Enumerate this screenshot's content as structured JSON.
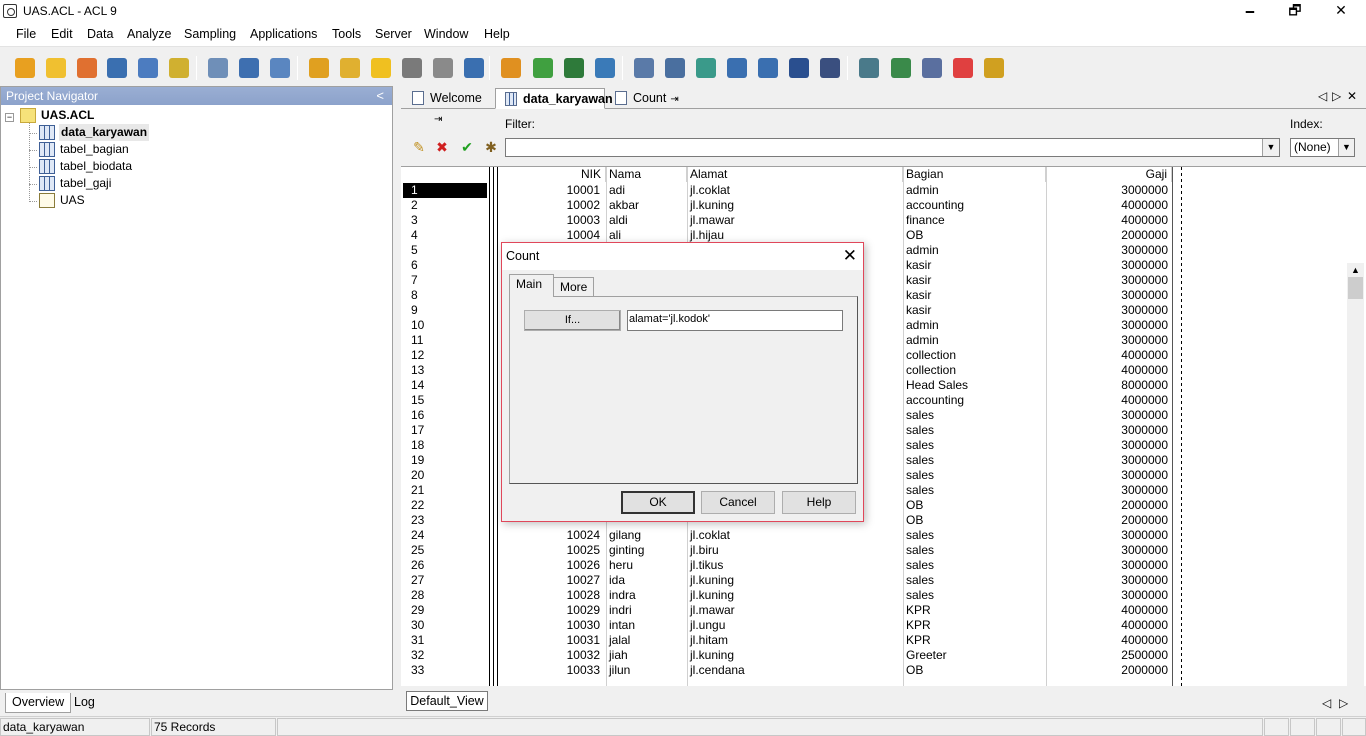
{
  "window": {
    "title": "UAS.ACL - ACL 9",
    "minimize": "🗕",
    "restore": "🗗",
    "close": "✕"
  },
  "menu": [
    "File",
    "Edit",
    "Data",
    "Analyze",
    "Sampling",
    "Applications",
    "Tools",
    "Server",
    "Window",
    "Help"
  ],
  "toolbar": {
    "icons": [
      {
        "name": "new-project-icon",
        "color": "#e8a020"
      },
      {
        "name": "open-project-icon",
        "color": "#f0c030"
      },
      {
        "name": "close-project-icon",
        "color": "#e07030"
      },
      {
        "name": "save-icon",
        "color": "#3a6fb0"
      },
      {
        "name": "print-icon",
        "color": "#4c7cc0"
      },
      {
        "name": "find-icon",
        "color": "#d0b030"
      },
      {
        "name": "refresh-icon",
        "color": "#6f8fb8"
      },
      {
        "name": "table-layout-icon",
        "color": "#3e6fb0"
      },
      {
        "name": "filter-icon",
        "color": "#5a86c0"
      },
      {
        "name": "copy-icon",
        "color": "#e0a020"
      },
      {
        "name": "edit-icon",
        "color": "#e0b030"
      },
      {
        "name": "add-column-icon",
        "color": "#f0c020"
      },
      {
        "name": "modify-column-icon",
        "color": "#7a7a7a"
      },
      {
        "name": "delete-column-icon",
        "color": "#8a8a8a"
      },
      {
        "name": "font-icon",
        "color": "#3a6fb0"
      },
      {
        "name": "chart-icon",
        "color": "#e09020"
      },
      {
        "name": "stratify-icon",
        "color": "#40a040"
      },
      {
        "name": "total-icon",
        "color": "#2e7a3a"
      },
      {
        "name": "percent-icon",
        "color": "#3a7ab8"
      },
      {
        "name": "relations-icon",
        "color": "#5a7aa8"
      },
      {
        "name": "join-icon",
        "color": "#4a6f9f"
      },
      {
        "name": "extract-icon",
        "color": "#3a9a8a"
      },
      {
        "name": "sequence-icon",
        "color": "#3a6fb0"
      },
      {
        "name": "sort-icon",
        "color": "#3a6fb0"
      },
      {
        "name": "age-icon",
        "color": "#2a4f8f"
      },
      {
        "name": "classify-icon",
        "color": "#3a4f7f"
      },
      {
        "name": "export-icon",
        "color": "#4a7a8a"
      },
      {
        "name": "script-icon",
        "color": "#3a8a4a"
      },
      {
        "name": "log-icon",
        "color": "#5a6f9f"
      },
      {
        "name": "layout-icon",
        "color": "#e04040"
      },
      {
        "name": "help-icon",
        "color": "#d0a020"
      }
    ]
  },
  "navigator": {
    "title": "Project Navigator",
    "collapse": "<",
    "project": "UAS.ACL",
    "items": [
      {
        "label": "data_karyawan",
        "bold": true,
        "type": "table"
      },
      {
        "label": "tabel_bagian",
        "type": "table"
      },
      {
        "label": "tabel_biodata",
        "type": "table"
      },
      {
        "label": "tabel_gaji",
        "type": "table"
      },
      {
        "label": "UAS",
        "type": "script"
      }
    ],
    "tabs": [
      "Overview",
      "Log"
    ]
  },
  "status": {
    "table": "data_karyawan",
    "records": "75 Records"
  },
  "doc_tabs": [
    "Welcome",
    "data_karyawan",
    "Count"
  ],
  "filter": {
    "label": "Filter:",
    "value": ""
  },
  "index": {
    "label": "Index:",
    "value": "(None)"
  },
  "grid": {
    "columns": [
      "NIK",
      "Nama",
      "Alamat",
      "Bagian",
      "Gaji"
    ],
    "rows": [
      [
        "1",
        "10001",
        "adi",
        "jl.coklat",
        "admin",
        "3000000"
      ],
      [
        "2",
        "10002",
        "akbar",
        "jl.kuning",
        "accounting",
        "4000000"
      ],
      [
        "3",
        "10003",
        "aldi",
        "jl.mawar",
        "finance",
        "4000000"
      ],
      [
        "4",
        "10004",
        "ali",
        "jl.hijau",
        "OB",
        "2000000"
      ],
      [
        "5",
        "",
        "",
        "",
        "admin",
        "3000000"
      ],
      [
        "6",
        "",
        "",
        "",
        "kasir",
        "3000000"
      ],
      [
        "7",
        "",
        "",
        "",
        "kasir",
        "3000000"
      ],
      [
        "8",
        "",
        "",
        "",
        "kasir",
        "3000000"
      ],
      [
        "9",
        "",
        "",
        "",
        "kasir",
        "3000000"
      ],
      [
        "10",
        "",
        "",
        "",
        "admin",
        "3000000"
      ],
      [
        "11",
        "",
        "",
        "",
        "admin",
        "3000000"
      ],
      [
        "12",
        "",
        "",
        "",
        "collection",
        "4000000"
      ],
      [
        "13",
        "",
        "",
        "",
        "collection",
        "4000000"
      ],
      [
        "14",
        "",
        "",
        "",
        "Head Sales",
        "8000000"
      ],
      [
        "15",
        "",
        "",
        "",
        "accounting",
        "4000000"
      ],
      [
        "16",
        "",
        "",
        "",
        "sales",
        "3000000"
      ],
      [
        "17",
        "",
        "",
        "",
        "sales",
        "3000000"
      ],
      [
        "18",
        "",
        "",
        "",
        "sales",
        "3000000"
      ],
      [
        "19",
        "",
        "",
        "",
        "sales",
        "3000000"
      ],
      [
        "20",
        "",
        "",
        "",
        "sales",
        "3000000"
      ],
      [
        "21",
        "",
        "",
        "",
        "sales",
        "3000000"
      ],
      [
        "22",
        "",
        "",
        "",
        "OB",
        "2000000"
      ],
      [
        "23",
        "",
        "",
        "",
        "OB",
        "2000000"
      ],
      [
        "24",
        "10024",
        "gilang",
        "jl.coklat",
        "sales",
        "3000000"
      ],
      [
        "25",
        "10025",
        "ginting",
        "jl.biru",
        "sales",
        "3000000"
      ],
      [
        "26",
        "10026",
        "heru",
        "jl.tikus",
        "sales",
        "3000000"
      ],
      [
        "27",
        "10027",
        "ida",
        "jl.kuning",
        "sales",
        "3000000"
      ],
      [
        "28",
        "10028",
        "indra",
        "jl.kuning",
        "sales",
        "3000000"
      ],
      [
        "29",
        "10029",
        "indri",
        "jl.mawar",
        "KPR",
        "4000000"
      ],
      [
        "30",
        "10030",
        "intan",
        "jl.ungu",
        "KPR",
        "4000000"
      ],
      [
        "31",
        "10031",
        "jalal",
        "jl.hitam",
        "KPR",
        "4000000"
      ],
      [
        "32",
        "10032",
        "jiah",
        "jl.kuning",
        "Greeter",
        "2500000"
      ],
      [
        "33",
        "10033",
        "jilun",
        "jl.cendana",
        "OB",
        "2000000"
      ]
    ]
  },
  "view_tab": "Default_View",
  "dialog": {
    "title": "Count",
    "close": "✕",
    "tabs": [
      "Main",
      "More"
    ],
    "if_button": "If...",
    "if_value": "alamat='jl.kodok'",
    "ok": "OK",
    "cancel": "Cancel",
    "help": "Help"
  }
}
